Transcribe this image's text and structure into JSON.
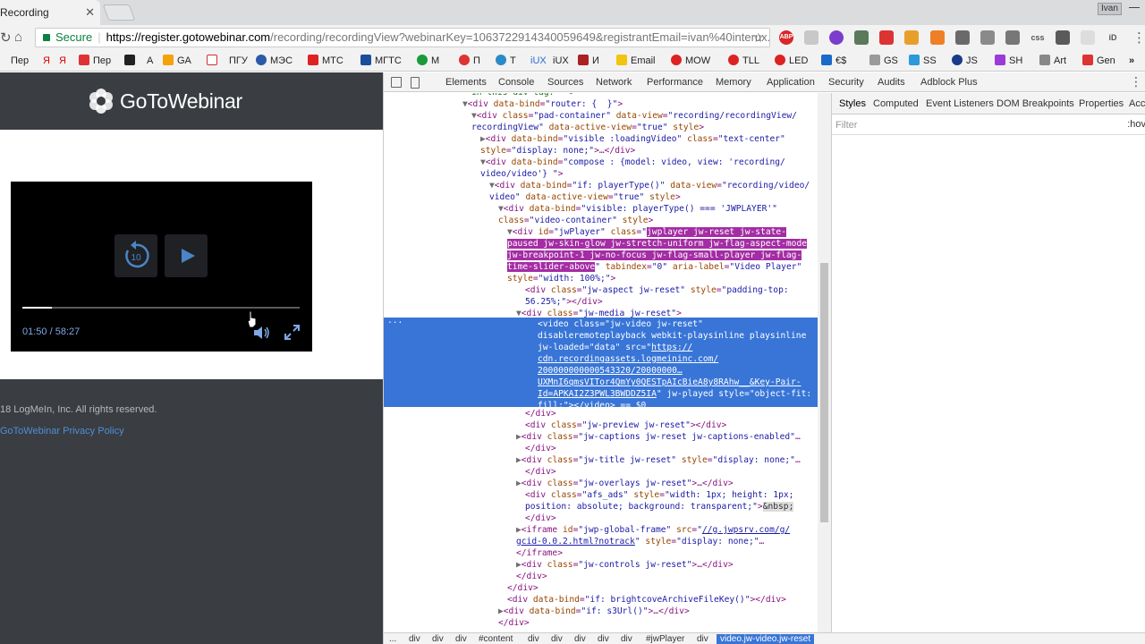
{
  "browser": {
    "tab_title": "Recording",
    "profile": "Ivan",
    "url_secure": "Secure",
    "url_host": "https://register.gotowebinar.com",
    "url_rest": "/recording/recordingView?webinarKey=1063722914340059649&registrantEmail=ivan%40interux...",
    "extensions": [
      "ABP",
      "",
      "",
      "",
      "",
      "",
      "",
      "",
      "css",
      "",
      "",
      "iD",
      ""
    ],
    "bookmarks": [
      "Пер",
      "Я",
      "Я",
      "Пер",
      "",
      "А",
      "GA",
      "",
      "ПГУ",
      "МЭС",
      "МТС",
      "МГТС",
      "М",
      "П",
      "Т",
      "iUX",
      "iUX",
      "И",
      "Email",
      "MOW",
      "TLL",
      "LED",
      "€$",
      "GS",
      "SS",
      "JS",
      "SH",
      "Art",
      "Gen"
    ]
  },
  "page": {
    "logo_text": "GoToWebinar",
    "player": {
      "current_time": "01:50",
      "separator": "/",
      "duration": "58:27",
      "progress_fraction": 0.108,
      "rewind_label": "10"
    },
    "copyright": "18 LogMeIn, Inc. All rights reserved.",
    "privacy_link": "GoToWebinar Privacy Policy"
  },
  "devtools": {
    "tabs": [
      "Elements",
      "Console",
      "Sources",
      "Network",
      "Performance",
      "Memory",
      "Application",
      "Security",
      "Audits",
      "Adblock Plus"
    ],
    "styles_tabs": [
      "Styles",
      "Computed",
      "Event Listeners",
      "DOM Breakpoints",
      "Properties",
      "Acce"
    ],
    "filter_placeholder": "Filter",
    "hov": ":hov",
    "dots": "...",
    "breadcrumbs": [
      "...",
      "div",
      "div",
      "div",
      "#content",
      "div",
      "div",
      "div",
      "div",
      "div",
      "#jwPlayer",
      "div",
      "video.jw-video.jw-reset"
    ]
  }
}
